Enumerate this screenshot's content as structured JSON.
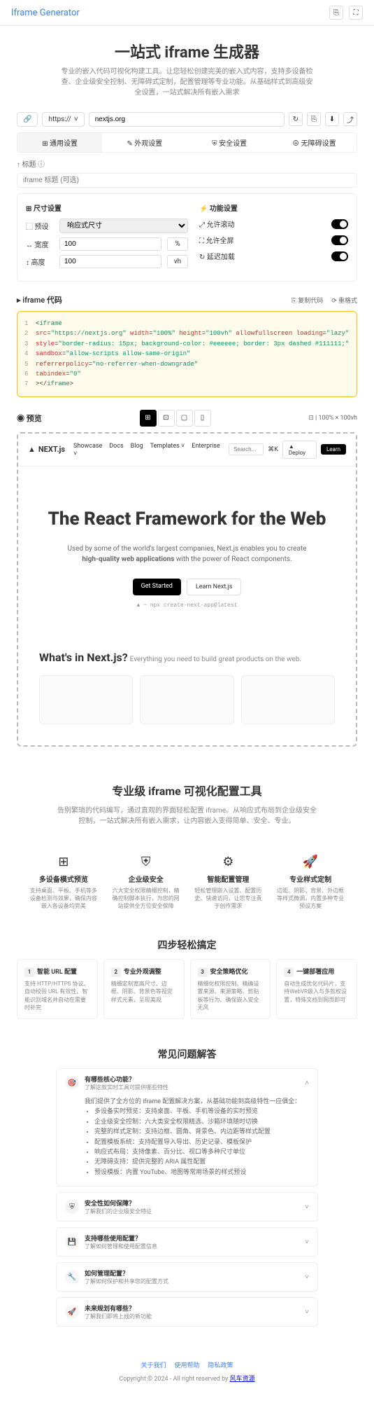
{
  "brand": "Iframe Generator",
  "hero": {
    "title": "一站式 iframe 生成器",
    "subtitle": "专业的嵌入代码可视化构建工具。让您轻松创建完美的嵌入式内容，支持多设备检查、企业级安全控制、无障碍式定制，配置管理等专业功能。从基础样式到高级安全设置，一站式解决所有嵌入需求"
  },
  "url": {
    "protocol": "https://",
    "value": "nextjs.org"
  },
  "tabs": [
    "⊞ 通用设置",
    "✎ 外观设置",
    "⛨ 安全设置",
    "⊕ 无障碍设置"
  ],
  "sectionLabel": "↑ 标题 ⓘ",
  "framePlaceholder": "iframe 标题 (可选)",
  "sizeSettings": {
    "title": "⊞ 尺寸设置",
    "preset": {
      "label": "⬚ 预设",
      "value": "响应式尺寸"
    },
    "width": {
      "label": "↔ 宽度",
      "value": "100",
      "unit": "%"
    },
    "height": {
      "label": "↕ 高度",
      "value": "100",
      "unit": "vh"
    }
  },
  "funcSettings": {
    "title": "⚡ 功能设置",
    "items": [
      "⤢ 允许滚动",
      "⛶ 允许全屏",
      "↻ 延迟加载"
    ]
  },
  "code": {
    "title": "▸ iframe 代码",
    "actions": [
      "⎘ 复制代码",
      "⟳ 重格式"
    ],
    "lines": [
      {
        "n": "1",
        "html": "&lt;<span class='tag'>iframe</span>"
      },
      {
        "n": "2",
        "html": "  <span class='attr'>src</span>=<span class='val'>\"https://nextjs.org\"</span> <span class='attr'>width</span>=<span class='val'>\"100%\"</span> <span class='attr'>height</span>=<span class='val'>\"100vh\"</span> <span class='attr'>allowfullscreen</span> <span class='attr'>loading</span>=<span class='val'>\"lazy\"</span>"
      },
      {
        "n": "3",
        "html": "  <span class='attr'>style</span>=<span class='val'>\"border-radius: 15px; background-color: #eeeeee; border: 3px dashed #111111;\"</span>"
      },
      {
        "n": "4",
        "html": "  <span class='attr'>sandbox</span>=<span class='val'>\"allow-scripts allow-same-origin\"</span>"
      },
      {
        "n": "5",
        "html": "  <span class='attr'>referrerpolicy</span>=<span class='val'>\"no-referrer-when-downgrade\"</span>"
      },
      {
        "n": "6",
        "html": "  <span class='attr'>tabindex</span>=<span class='val'>\"0\"</span>"
      },
      {
        "n": "7",
        "html": "&gt;&lt;/<span class='tag'>iframe</span>&gt;"
      }
    ]
  },
  "preview": {
    "title": "◉ 预览",
    "size": "⊡ | 100% × 100vh"
  },
  "nextjs": {
    "logo": "NEXT.js",
    "nav": [
      "Showcase",
      "Docs",
      "Blog",
      "Templates ˅",
      "Enterprise ˅"
    ],
    "search": "Search...",
    "kbd": "⌘K",
    "deploy": "▲ Deploy",
    "learn": "Learn",
    "heroTitle": "The React Framework for the Web",
    "heroText1": "Used by some of the world's largest companies, Next.js enables you to create",
    "heroText2": "high-quality web applications",
    "heroText3": " with the power of React components.",
    "getStarted": "Get Started",
    "learnNext": "Learn Next.js",
    "cmd": "▲ ~ npx create-next-app@latest",
    "whatsTitle": "What's in Next.js?",
    "whatsSub": "Everything you need to build great products on the web."
  },
  "featSection": {
    "title": "专业级 iframe 可视化配置工具",
    "subtitle": "告别繁琐的代码编写，通过直观的界面轻松配置 iframe。从响应式布局到企业级安全控制，一站式解决所有嵌入需求，让内容嵌入变得简单、安全、专业。"
  },
  "features": [
    {
      "icon": "⊞",
      "title": "多设备模式预览",
      "desc": "支持桌面、平板、手机等多设备检测与效果，确保内容嵌入各设备均完美"
    },
    {
      "icon": "⛨",
      "title": "企业级安全",
      "desc": "六大安全权限精细控制，精确控制脚本执行，为您的网站提供全方位安全保障"
    },
    {
      "icon": "⚙",
      "title": "智能配置管理",
      "desc": "轻松管理嵌入设置、配置历史、快速访问，让您专注责于创作需求"
    },
    {
      "icon": "🚀",
      "title": "专业样式定制",
      "desc": "边距、阴影、背景、外边框等样式微调，内置多种专业预设方案"
    }
  ],
  "stepsTitle": "四步轻松搞定",
  "steps": [
    {
      "n": "1",
      "title": "智能 URL 配置",
      "desc": "支持 HTTP/HTTPS 协议、自动校验 URL 有效性、智能识别域名并自动在需要时补完"
    },
    {
      "n": "2",
      "title": "专业外观调整",
      "desc": "精细定制宽高尺寸、边框、阴影、背景色等视觉样式元素，呈现美观"
    },
    {
      "n": "3",
      "title": "安全策略优化",
      "desc": "精细化权限控制、精确设置来源、来源策略、剪贴板等行为、确保嵌入安全无风"
    },
    {
      "n": "4",
      "title": "一键部署应用",
      "desc": "自动生成优化代码片，支持WebVR嵌入与多款权设置，特殊文档到网页即可"
    }
  ],
  "faqTitle": "常见问题解答",
  "faqs": [
    {
      "icon": "🎯",
      "q": "有哪些核心功能？",
      "sub": "了解这款实时工具可提供哪些特性",
      "open": true,
      "intro": "我们提供了全方位的 iframe 配置解决方案，从基础功能到高级特性一应俱全：",
      "items": [
        "多设备实时预览：支持桌面、平板、手机等设备的实时预览",
        "企业级安全控制：六大类安全权限精选、沙箱环境随时切换",
        "完整的样式定制：支持边框、圆角、背景色、内边距等样式配置",
        "配置模板系统：支持配置导入导出、历史记录、模板保护",
        "响应式布局：支持像素、百分比、视口等多种尺寸单位",
        "无障碍支持：提供完整的 ARIA 属性配置",
        "预设模板：内置 YouTube、地图等常用场景的样式预设"
      ]
    },
    {
      "icon": "⛨",
      "q": "安全性如何保障？",
      "sub": "了解我们的企业级安全特征"
    },
    {
      "icon": "💾",
      "q": "支持哪些使用配置？",
      "sub": "了解如何管理和使用配置信息"
    },
    {
      "icon": "🔧",
      "q": "如何管理配置？",
      "sub": "了解如何保护和共享您的配置方式"
    },
    {
      "icon": "🚀",
      "q": "未来规划有哪些？",
      "sub": "了解我们即将上线的新功能"
    }
  ],
  "footer": {
    "links": [
      "关于我们",
      "使用帮助",
      "隐私政策"
    ],
    "copyright": "Copyright © 2024 - All right reserved by ",
    "brand": "风车资源"
  }
}
